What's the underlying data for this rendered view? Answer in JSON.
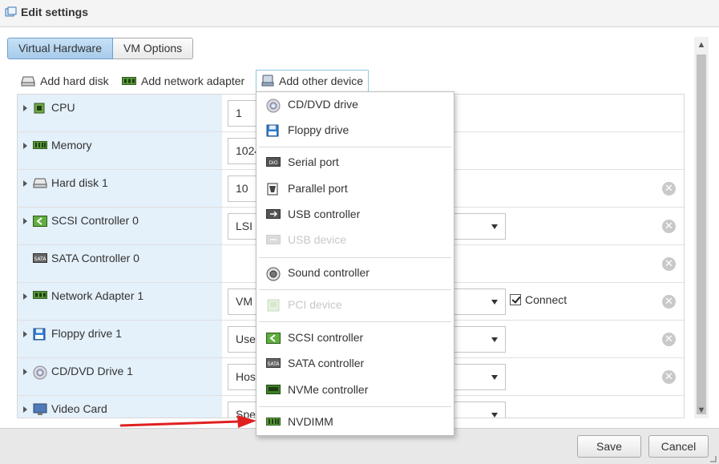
{
  "dialog": {
    "title": "Edit settings",
    "title_icon": "settings-window-icon"
  },
  "tabs": [
    {
      "label": "Virtual Hardware",
      "active": true
    },
    {
      "label": "VM Options",
      "active": false
    }
  ],
  "toolbar": {
    "add_hard_disk": "Add hard disk",
    "add_network_adapter": "Add network adapter",
    "add_other_device": "Add other device"
  },
  "hardware": [
    {
      "name": "CPU",
      "icon": "cpu-icon",
      "value": "1",
      "expandable": true,
      "removable": false
    },
    {
      "name": "Memory",
      "icon": "memory-icon",
      "value": "1024",
      "expandable": true,
      "removable": false
    },
    {
      "name": "Hard disk 1",
      "icon": "hard-disk-icon",
      "value": "10",
      "expandable": true,
      "removable": true
    },
    {
      "name": "SCSI Controller 0",
      "icon": "scsi-icon",
      "value": "LSI",
      "expandable": true,
      "removable": true
    },
    {
      "name": "SATA Controller 0",
      "icon": "sata-icon",
      "value": "",
      "expandable": false,
      "removable": true
    },
    {
      "name": "Network Adapter 1",
      "icon": "network-icon",
      "value": "VM N",
      "expandable": true,
      "removable": true,
      "connect_label": "Connect",
      "connected": true
    },
    {
      "name": "Floppy drive 1",
      "icon": "floppy-icon",
      "value": "Use",
      "expandable": true,
      "removable": true
    },
    {
      "name": "CD/DVD Drive 1",
      "icon": "cd-icon",
      "value": "Hos",
      "expandable": true,
      "removable": true
    },
    {
      "name": "Video Card",
      "icon": "video-card-icon",
      "value": "Spe",
      "expandable": true,
      "removable": false
    }
  ],
  "menu": {
    "items": [
      {
        "label": "CD/DVD drive",
        "icon": "cd-icon",
        "enabled": true
      },
      {
        "label": "Floppy drive",
        "icon": "floppy-icon",
        "enabled": true
      },
      {
        "label": "Serial port",
        "icon": "serial-port-icon",
        "enabled": true
      },
      {
        "label": "Parallel port",
        "icon": "parallel-port-icon",
        "enabled": true
      },
      {
        "label": "USB controller",
        "icon": "usb-icon",
        "enabled": true
      },
      {
        "label": "USB device",
        "icon": "usb-device-icon",
        "enabled": false
      },
      {
        "label": "Sound controller",
        "icon": "speaker-icon",
        "enabled": true
      },
      {
        "label": "PCI device",
        "icon": "pci-icon",
        "enabled": false
      },
      {
        "label": "SCSI controller",
        "icon": "scsi-icon",
        "enabled": true
      },
      {
        "label": "SATA controller",
        "icon": "sata-icon",
        "enabled": true
      },
      {
        "label": "NVMe controller",
        "icon": "nvme-icon",
        "enabled": true
      },
      {
        "label": "NVDIMM",
        "icon": "nvdimm-icon",
        "enabled": true
      }
    ]
  },
  "footer": {
    "save": "Save",
    "cancel": "Cancel"
  },
  "colors": {
    "accent": "#a7cbea",
    "label_bg": "#e4f0fa",
    "annotation_arrow": "#e02020"
  }
}
